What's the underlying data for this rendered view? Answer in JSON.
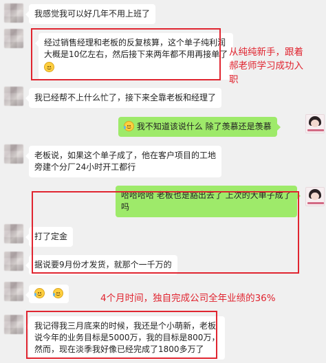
{
  "messages": [
    {
      "id": "m1",
      "side": "left",
      "lines": [
        "我感觉我可以好几年不用上班了"
      ]
    },
    {
      "id": "m2",
      "side": "left",
      "lines": [
        "经过销售经理和老板的反复核算，这个单子纯利润",
        "大概是10亿左右，然后接下来两年都不用再接单了"
      ],
      "emoji": "grimace-emoji"
    },
    {
      "id": "m3",
      "side": "left",
      "lines": [
        "我已经帮不上什么忙了，接下来全靠老板和经理了"
      ]
    },
    {
      "id": "m4",
      "side": "right",
      "lines": [
        "我不知道该说什么  除了羡慕还是羡慕"
      ],
      "emoji": "laugh-cry-emoji"
    },
    {
      "id": "m5",
      "side": "left",
      "lines": [
        "老板说，如果这个单子成了，他在客户项目的工地",
        "旁建个分厂24小时开工都行"
      ]
    },
    {
      "id": "m6",
      "side": "right",
      "lines": [
        "哈哈哈哈   老板也是豁出去了  上次的大单子成了",
        "吗"
      ]
    },
    {
      "id": "m7",
      "side": "left",
      "lines": [
        "打了定金"
      ]
    },
    {
      "id": "m8",
      "side": "left",
      "lines": [
        "据说要9月份才发货，就那个一千万的"
      ]
    },
    {
      "id": "m9",
      "side": "left",
      "emoji_only": true
    },
    {
      "id": "m10",
      "side": "left",
      "lines": [
        "我记得我三月底来的时候，我还是个小萌新，老板",
        "说今年的业务目标是5000万，我的目标是800万，",
        "然而，现在淡季我好像已经完成了1800多万了"
      ]
    }
  ],
  "annotations": {
    "top_right": [
      "从纯纯新手，跟着",
      "郝老师学习成功入",
      "职"
    ],
    "middle": "4个月时间，独自完成公司全年业绩的36%"
  },
  "colors": {
    "background": "#f0f0f0",
    "bubble_left": "#ffffff",
    "bubble_right": "#9eea6a",
    "annotation_red": "#e0242f"
  }
}
